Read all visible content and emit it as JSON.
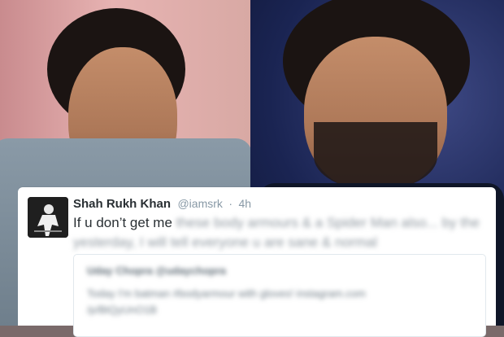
{
  "tweet": {
    "display_name": "Shah Rukh Khan",
    "handle": "@iamsrk",
    "separator": "·",
    "time": "4h",
    "visible_text": "If u don’t get me",
    "blurred_text": "these body armours & a Spider Man also... by the yesterday, I will tell everyone u are sane & normal"
  },
  "quoted_tweet": {
    "author": "Uday Chopra @udaychopra",
    "line1": "Today I'm batman #bodyarmour with gloves! instagram.com",
    "line2": "/p/BtQyUnO1B"
  }
}
